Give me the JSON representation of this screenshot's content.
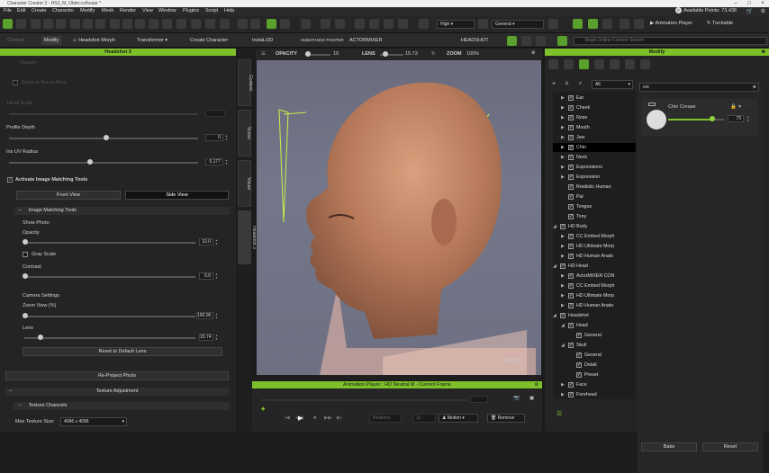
{
  "app": {
    "title": "Character Creator 3 - HS3_M_Older.ccAvatar *",
    "available_points_label": "Available Points: 73,438"
  },
  "menu": [
    "File",
    "Edit",
    "Create",
    "Character",
    "Modify",
    "Mesh",
    "Render",
    "View",
    "Window",
    "Plugins",
    "Script",
    "Help"
  ],
  "toolbar1": {
    "quality": "High",
    "shading": "General",
    "animation_player": "Animation Player",
    "turntable": "Turntable"
  },
  "toolbar2": {
    "content": "Content",
    "modify": "Modify",
    "headshot_morph": "Headshot Morph",
    "transformer": "Transformer",
    "create_character": "Create Character",
    "instalod": "InstaLOD",
    "substance": "SUBSTANCE PAINTER",
    "actormixer": "ACTORMIXER",
    "headshot": "HEADSHOT",
    "search_placeholder": "Begin Online Content Search"
  },
  "left_panel": {
    "title": "Headshot 3",
    "dim_label1": "Opacity",
    "dim_label2": "Zoom to Focus Area",
    "dim_label3": "Head Scale",
    "profile_depth_label": "Profile Depth",
    "profile_depth_value": "0",
    "iris_uv_label": "Iris UV Radius",
    "iris_uv_value": "0.177",
    "image_matching_checkbox": "Activate Image Matching Tools",
    "front_view": "Front View",
    "side_view": "Side View",
    "image_matching_tools": "Image Matching Tools",
    "show_photo": "Show Photo",
    "opacity_label": "Opacity",
    "opacity_value": "10.0",
    "gray_scale": "Gray Scale",
    "contrast_label": "Contrast",
    "contrast_value": "0.0",
    "camera_settings": "Camera Settings",
    "zoom_view_label": "Zoom View (%)",
    "zoom_view_value": "100.00",
    "lens_label": "Lens",
    "lens_value": "15.74",
    "reset_default_lens": "Reset to Default Lens",
    "reproject_photo": "Re-Project Photo",
    "texture_adjustment": "Texture Adjustment",
    "texture_channels": "Texture Channels",
    "max_texture_size_label": "Max Texture Size:",
    "max_texture_size_value": "4096 x 4096"
  },
  "side_tabs": [
    "Content",
    "Scene",
    "Visual",
    "Headshot 3"
  ],
  "viewport": {
    "opacity_label": "OPACITY",
    "opacity_value": "10",
    "lens_label": "LENS",
    "lens_value": "15.73",
    "zoom_label": "ZOOM",
    "zoom_value": "100%",
    "subd_label": "SubD 0"
  },
  "anim": {
    "title": "Animation Player : HD Neutral M - Current Frame",
    "realtime": "Realtime",
    "fps": "1x",
    "motion": "Motion",
    "remove": "Remove"
  },
  "right_panel": {
    "title": "Modify",
    "filter": "All",
    "search_value": "cre",
    "slider_label": "Chin Crease",
    "slider_value": "79",
    "slider_fraction": 0.79,
    "bake": "Bake",
    "reset": "Reset",
    "tree": [
      {
        "label": "Ear",
        "indent": 2,
        "arrow": "▶"
      },
      {
        "label": "Cheek",
        "indent": 2,
        "arrow": "▶"
      },
      {
        "label": "Nose",
        "indent": 2,
        "arrow": "▶"
      },
      {
        "label": "Mouth",
        "indent": 2,
        "arrow": "▶"
      },
      {
        "label": "Jaw",
        "indent": 2,
        "arrow": "▶"
      },
      {
        "label": "Chin",
        "indent": 2,
        "arrow": "▶",
        "selected": true
      },
      {
        "label": "Neck",
        "indent": 2,
        "arrow": "▶"
      },
      {
        "label": "Expressions",
        "indent": 2,
        "arrow": "▶"
      },
      {
        "label": "Expression",
        "indent": 2,
        "arrow": "▶"
      },
      {
        "label": "Realistic Human",
        "indent": 2,
        "arrow": ""
      },
      {
        "label": "Pal",
        "indent": 2,
        "arrow": ""
      },
      {
        "label": "Tongue",
        "indent": 2,
        "arrow": ""
      },
      {
        "label": "Tony",
        "indent": 2,
        "arrow": ""
      },
      {
        "label": "HD Body",
        "indent": 1,
        "arrow": "◢"
      },
      {
        "label": "CC Embed Morph",
        "indent": 2,
        "arrow": "▶"
      },
      {
        "label": "HD Ultimate Morp",
        "indent": 2,
        "arrow": "▶"
      },
      {
        "label": "HD Human Anato",
        "indent": 2,
        "arrow": "▶"
      },
      {
        "label": "HD Head",
        "indent": 1,
        "arrow": "◢"
      },
      {
        "label": "ActorMIXER CON",
        "indent": 2,
        "arrow": "▶"
      },
      {
        "label": "CC Embed Morph",
        "indent": 2,
        "arrow": "▶"
      },
      {
        "label": "HD Ultimate Morp",
        "indent": 2,
        "arrow": "▶"
      },
      {
        "label": "HD Human Anato",
        "indent": 2,
        "arrow": "▶"
      },
      {
        "label": "Headshot",
        "indent": 1,
        "arrow": "◢"
      },
      {
        "label": "Head",
        "indent": 2,
        "arrow": "◢"
      },
      {
        "label": "General",
        "indent": 3,
        "arrow": ""
      },
      {
        "label": "Skull",
        "indent": 2,
        "arrow": "◢"
      },
      {
        "label": "General",
        "indent": 3,
        "arrow": ""
      },
      {
        "label": "Detail",
        "indent": 3,
        "arrow": ""
      },
      {
        "label": "Preset",
        "indent": 3,
        "arrow": ""
      },
      {
        "label": "Face",
        "indent": 2,
        "arrow": "▶"
      },
      {
        "label": "Forehead",
        "indent": 2,
        "arrow": "▶"
      }
    ]
  },
  "colors": {
    "accent": "#7ec02a"
  }
}
